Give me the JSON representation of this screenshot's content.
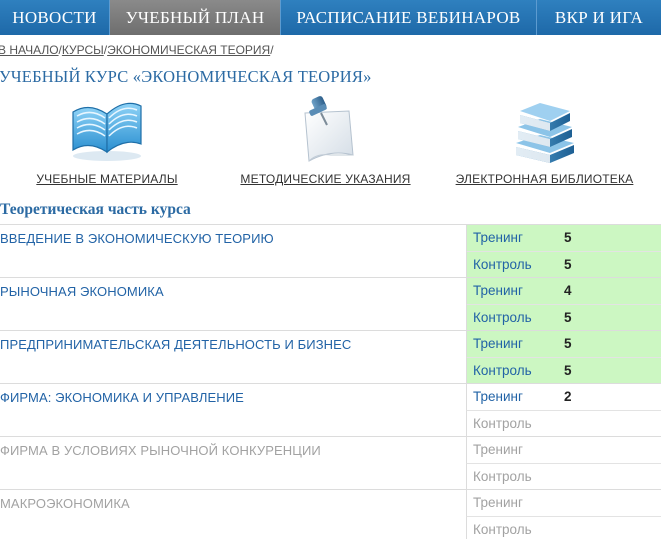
{
  "nav": {
    "items": [
      {
        "label": "НОВОСТИ",
        "active": false
      },
      {
        "label": "УЧЕБНЫЙ ПЛАН",
        "active": true
      },
      {
        "label": "РАСПИСАНИЕ ВЕБИНАРОВ",
        "active": false
      },
      {
        "label": "ВКР И ИГА",
        "active": false
      }
    ]
  },
  "breadcrumb": {
    "items": [
      "В НАЧАЛО",
      "КУРСЫ",
      "ЭКОНОМИЧЕСКАЯ ТЕОРИЯ"
    ],
    "separator": "/"
  },
  "course_title": "УЧЕБНЫЙ КУРС «ЭКОНОМИЧЕСКАЯ ТЕОРИЯ»",
  "resources": [
    {
      "label": "УЧЕБНЫЕ МАТЕРИАЛЫ",
      "icon": "open-book-icon"
    },
    {
      "label": "МЕТОДИЧЕСКИЕ УКАЗАНИЯ",
      "icon": "pinned-note-icon"
    },
    {
      "label": "ЭЛЕКТРОННАЯ БИБЛИОТЕКА",
      "icon": "book-stack-icon"
    }
  ],
  "section_title": "Теоретическая часть курса",
  "modules": [
    {
      "name": "ВВЕДЕНИЕ В ЭКОНОМИЧЕСКУЮ ТЕОРИЮ",
      "status": "done",
      "training": {
        "label": "Тренинг",
        "score": "5",
        "state": "passed"
      },
      "control": {
        "label": "Контроль",
        "score": "5",
        "state": "passed"
      }
    },
    {
      "name": "РЫНОЧНАЯ ЭКОНОМИКА",
      "status": "done",
      "training": {
        "label": "Тренинг",
        "score": "4",
        "state": "passed"
      },
      "control": {
        "label": "Контроль",
        "score": "5",
        "state": "passed"
      }
    },
    {
      "name": "ПРЕДПРИНИМАТЕЛЬСКАЯ ДЕЯТЕЛЬНОСТЬ И БИЗНЕС",
      "status": "done",
      "training": {
        "label": "Тренинг",
        "score": "5",
        "state": "passed"
      },
      "control": {
        "label": "Контроль",
        "score": "5",
        "state": "passed"
      }
    },
    {
      "name": "ФИРМА: ЭКОНОМИКА И УПРАВЛЕНИЕ",
      "status": "done",
      "training": {
        "label": "Тренинг",
        "score": "2",
        "state": "active"
      },
      "control": {
        "label": "Контроль",
        "score": "",
        "state": "disabled"
      }
    },
    {
      "name": "ФИРМА В УСЛОВИЯХ РЫНОЧНОЙ КОНКУРЕНЦИИ",
      "status": "disabled",
      "training": {
        "label": "Тренинг",
        "score": "",
        "state": "disabled"
      },
      "control": {
        "label": "Контроль",
        "score": "",
        "state": "disabled"
      }
    },
    {
      "name": "МАКРОЭКОНОМИКА",
      "status": "disabled",
      "training": {
        "label": "Тренинг",
        "score": "",
        "state": "disabled"
      },
      "control": {
        "label": "Контроль",
        "score": "",
        "state": "disabled"
      }
    }
  ],
  "colors": {
    "nav_bg": "#2474b5",
    "nav_active": "#7a7a7a",
    "link_blue": "#2263a6",
    "passed_bg": "#ccf7c2",
    "disabled_text": "#a2a2a2"
  }
}
